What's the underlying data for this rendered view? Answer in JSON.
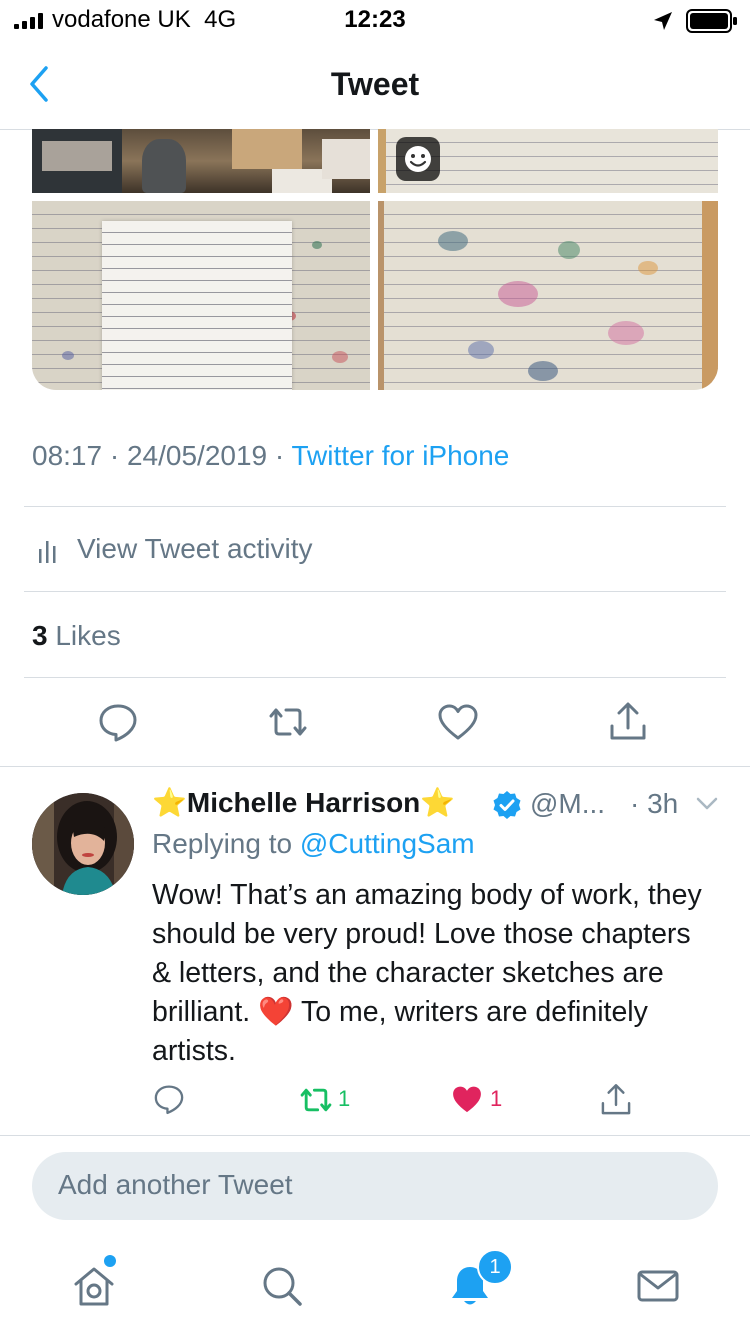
{
  "status_bar": {
    "carrier": "vodafone UK",
    "network": "4G",
    "time": "12:23"
  },
  "nav": {
    "title": "Tweet"
  },
  "tweet": {
    "time": "08:17",
    "date": "24/05/2019",
    "source": "Twitter for iPhone",
    "activity_label": "View Tweet activity",
    "likes_count": "3",
    "likes_label": "Likes"
  },
  "reply": {
    "name": "⭐Michelle Harrison⭐",
    "verified": true,
    "handle": "@M...",
    "time": "3h",
    "replying_prefix": "Replying to",
    "replying_to": "@CuttingSam",
    "text": "Wow! That’s an amazing body of work, they should be very proud! Love those chapters & letters, and the character sketches are brilliant. ❤️ To me, writers are definitely artists.",
    "retweet_count": "1",
    "like_count": "1",
    "liked": true
  },
  "compose": {
    "placeholder": "Add another Tweet"
  },
  "tab_bar": {
    "notification_badge": "1",
    "active": "notifications"
  },
  "colors": {
    "accent": "#1da1f2",
    "retweet": "#17bf63",
    "like": "#e0245e",
    "secondary_text": "#657786"
  }
}
